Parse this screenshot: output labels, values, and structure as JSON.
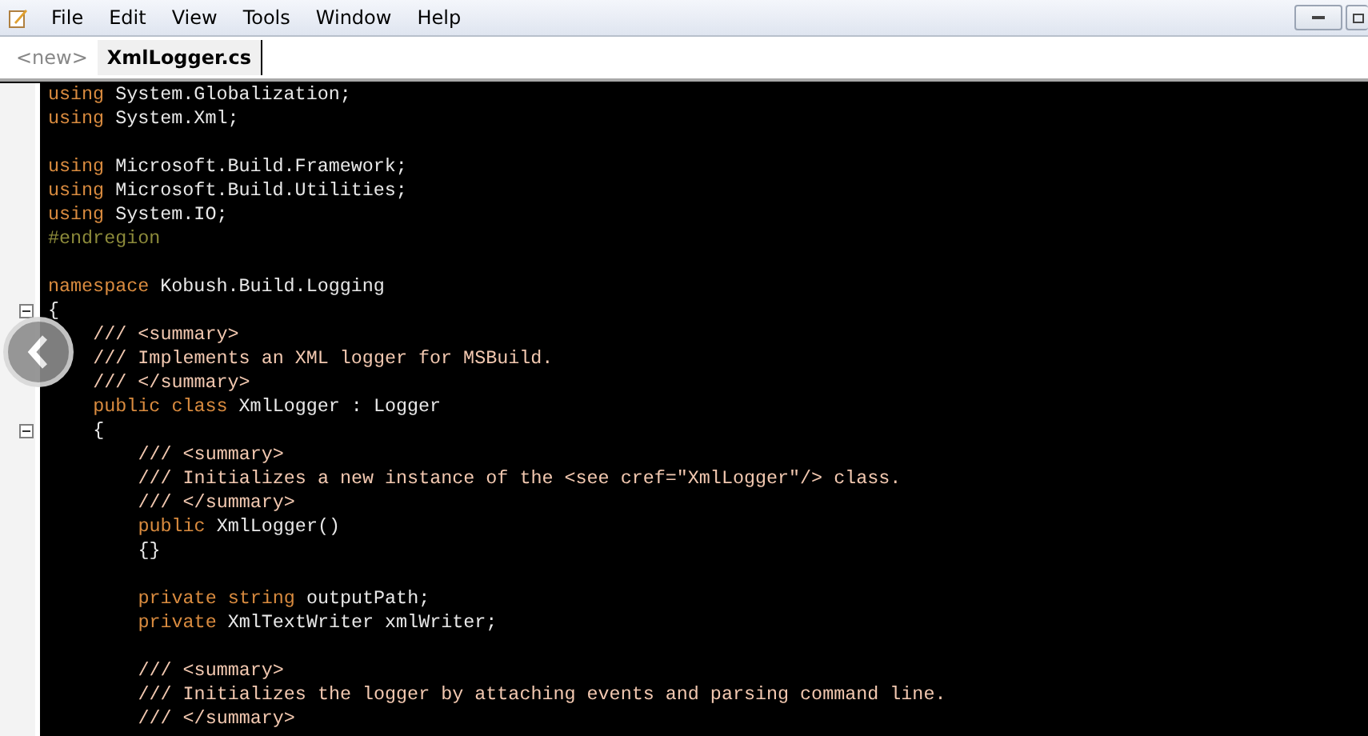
{
  "menu": [
    "File",
    "Edit",
    "View",
    "Tools",
    "Window",
    "Help"
  ],
  "tabs": [
    {
      "label": "<new>",
      "selected": false
    },
    {
      "label": "XmlLogger.cs",
      "selected": true
    }
  ],
  "lines": [
    {
      "segments": [
        {
          "kind": "keyword",
          "text": "using"
        },
        {
          "kind": "text",
          "text": " System.Globalization;"
        }
      ]
    },
    {
      "segments": [
        {
          "kind": "keyword",
          "text": "using"
        },
        {
          "kind": "text",
          "text": " System.Xml;"
        }
      ]
    },
    {
      "kind": "blank"
    },
    {
      "segments": [
        {
          "kind": "keyword",
          "text": "using"
        },
        {
          "kind": "text",
          "text": " Microsoft.Build.Framework;"
        }
      ]
    },
    {
      "segments": [
        {
          "kind": "keyword",
          "text": "using"
        },
        {
          "kind": "text",
          "text": " Microsoft.Build.Utilities;"
        }
      ]
    },
    {
      "segments": [
        {
          "kind": "keyword",
          "text": "using"
        },
        {
          "kind": "text",
          "text": " System.IO;"
        }
      ]
    },
    {
      "segments": [
        {
          "kind": "preproc",
          "text": "#endregion"
        }
      ]
    },
    {
      "kind": "blank"
    },
    {
      "segments": [
        {
          "kind": "keyword",
          "text": "namespace"
        },
        {
          "kind": "text",
          "text": " Kobush.Build.Logging"
        }
      ]
    },
    {
      "segments": [
        {
          "kind": "text",
          "text": "{"
        }
      ],
      "expanded": true
    },
    {
      "segments": [
        {
          "kind": "comment",
          "text": "    /// <summary>"
        }
      ]
    },
    {
      "segments": [
        {
          "kind": "comment",
          "text": "    /// Implements an XML logger for MSBuild."
        }
      ]
    },
    {
      "segments": [
        {
          "kind": "comment",
          "text": "    /// </summary>"
        }
      ]
    },
    {
      "segments": [
        {
          "kind": "keyword",
          "text": "    public class"
        },
        {
          "kind": "text",
          "text": " XmlLogger : Logger"
        }
      ]
    },
    {
      "segments": [
        {
          "kind": "text",
          "text": "    {"
        }
      ],
      "expanded": true
    },
    {
      "segments": [
        {
          "kind": "comment",
          "text": "        /// <summary>"
        }
      ]
    },
    {
      "segments": [
        {
          "kind": "comment",
          "text": "        /// Initializes a new instance of the <see cref=\"XmlLogger\"/> class."
        }
      ]
    },
    {
      "segments": [
        {
          "kind": "comment",
          "text": "        /// </summary>"
        }
      ]
    },
    {
      "segments": [
        {
          "kind": "keyword",
          "text": "        public"
        },
        {
          "kind": "text",
          "text": " XmlLogger()"
        }
      ]
    },
    {
      "segments": [
        {
          "kind": "text",
          "text": "        {}"
        }
      ]
    },
    {
      "kind": "blank"
    },
    {
      "segments": [
        {
          "kind": "keyword",
          "text": "        private string"
        },
        {
          "kind": "text",
          "text": " outputPath;"
        }
      ]
    },
    {
      "segments": [
        {
          "kind": "keyword",
          "text": "        private"
        },
        {
          "kind": "text",
          "text": " XmlTextWriter xmlWriter;"
        }
      ]
    },
    {
      "kind": "blank"
    },
    {
      "segments": [
        {
          "kind": "comment",
          "text": "        /// <summary>"
        }
      ]
    },
    {
      "segments": [
        {
          "kind": "comment",
          "text": "        /// Initializes the logger by attaching events and parsing command line."
        }
      ]
    },
    {
      "segments": [
        {
          "kind": "comment",
          "text": "        /// </summary>"
        }
      ]
    }
  ]
}
